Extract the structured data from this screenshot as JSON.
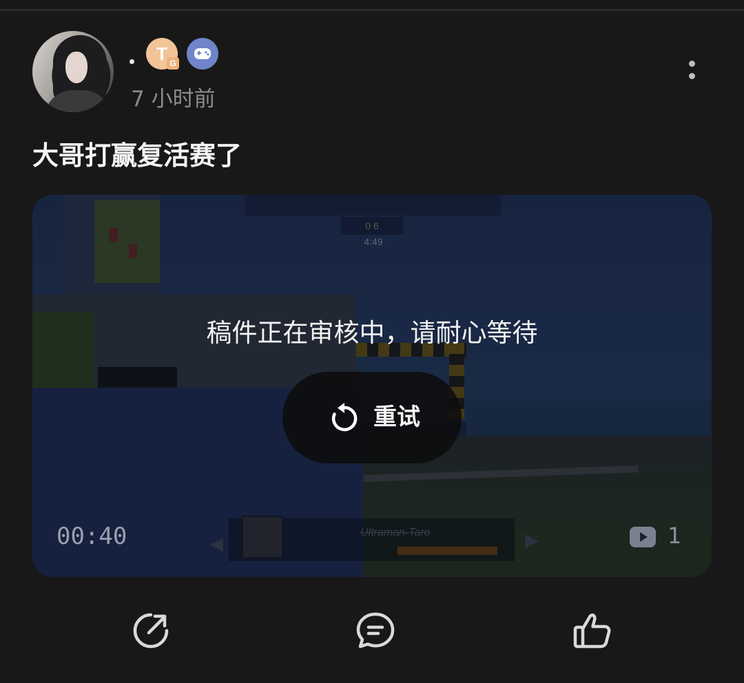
{
  "post": {
    "author_separator": "·",
    "badge_t": "T",
    "badge_t_sub": "G",
    "time_ago": "7 小时前",
    "title": "大哥打赢复活赛了"
  },
  "video": {
    "hud_score": "0  6",
    "hud_time": "4:49",
    "player_name": "Ultraman-Taro",
    "review_message": "稿件正在审核中，请耐心等待",
    "retry_label": "重试",
    "duration": "00:40",
    "play_count": "1"
  },
  "icons": {
    "more": "more-vertical-icon",
    "retry": "refresh-icon",
    "share": "share-icon",
    "comment": "comment-icon",
    "like": "thumbs-up-icon",
    "play_count": "play-count-icon"
  },
  "colors": {
    "background": "#181818",
    "badge_t": "#f2c49a",
    "badge_game": "#6f84c9",
    "muted_text": "#8c8c8c"
  }
}
